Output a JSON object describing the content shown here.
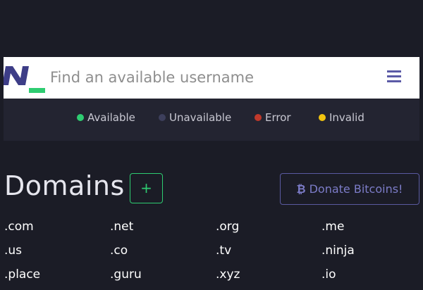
{
  "search": {
    "placeholder": "Find an available username"
  },
  "legend": [
    {
      "label": "Available",
      "color": "#2ecc71"
    },
    {
      "label": "Unavailable",
      "color": "#3d3f5c"
    },
    {
      "label": "Error",
      "color": "#c0392b"
    },
    {
      "label": "Invalid",
      "color": "#f1c40f"
    }
  ],
  "domains": {
    "title": "Domains",
    "add_label": "+",
    "donate_label": "Donate Bitcoins!",
    "donate_icon": "bitcoin-icon",
    "items": [
      ".com",
      ".net",
      ".org",
      ".me",
      ".us",
      ".co",
      ".tv",
      ".ninja",
      ".place",
      ".guru",
      ".xyz",
      ".io"
    ]
  },
  "colors": {
    "brand": "#3d3d87",
    "accent": "#2ecc71",
    "background": "#1b1c26",
    "legend_bg": "#232431"
  }
}
